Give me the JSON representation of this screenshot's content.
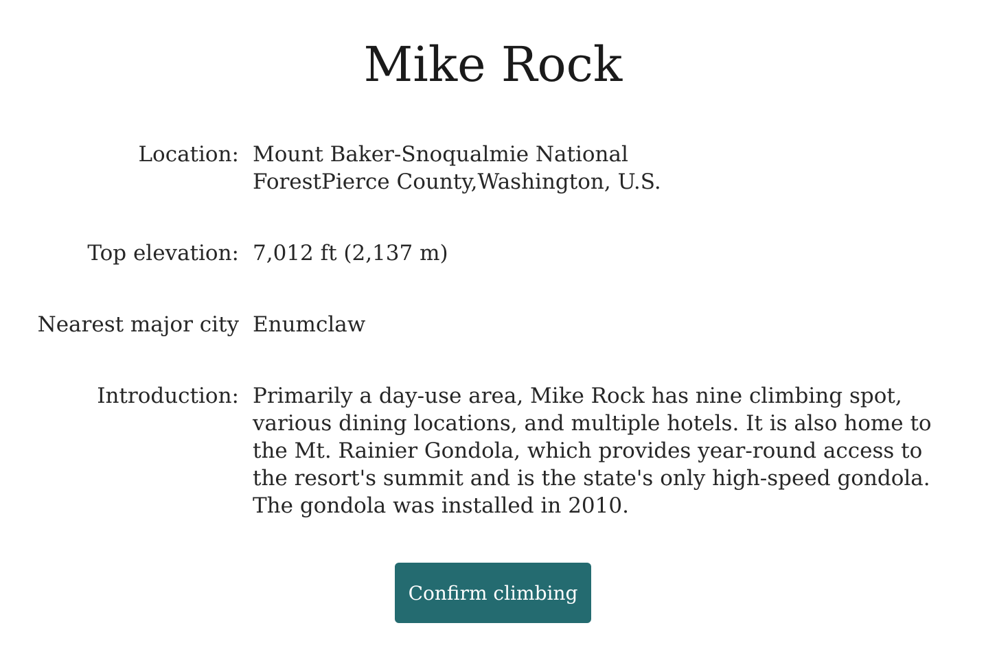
{
  "title": "Mike Rock",
  "details": {
    "location": {
      "label": "Location:",
      "value": "Mount Baker-Snoqualmie National ForestPierce County,Washington, U.S."
    },
    "elevation": {
      "label": "Top elevation:",
      "value": "7,012 ft (2,137 m)"
    },
    "city": {
      "label": "Nearest major city",
      "value": "Enumclaw"
    },
    "introduction": {
      "label": "Introduction:",
      "value": "Primarily a day-use area, Mike Rock has nine climbing spot, various dining locations, and multiple hotels. It is also home to the Mt. Rainier Gondola, which provides year-round access to the resort's summit and is the state's only high-speed gondola. The gondola was installed in 2010."
    }
  },
  "actions": {
    "confirm_label": "Confirm climbing"
  },
  "colors": {
    "button_bg": "#246b70",
    "button_text": "#ffffff",
    "text": "#262626"
  }
}
